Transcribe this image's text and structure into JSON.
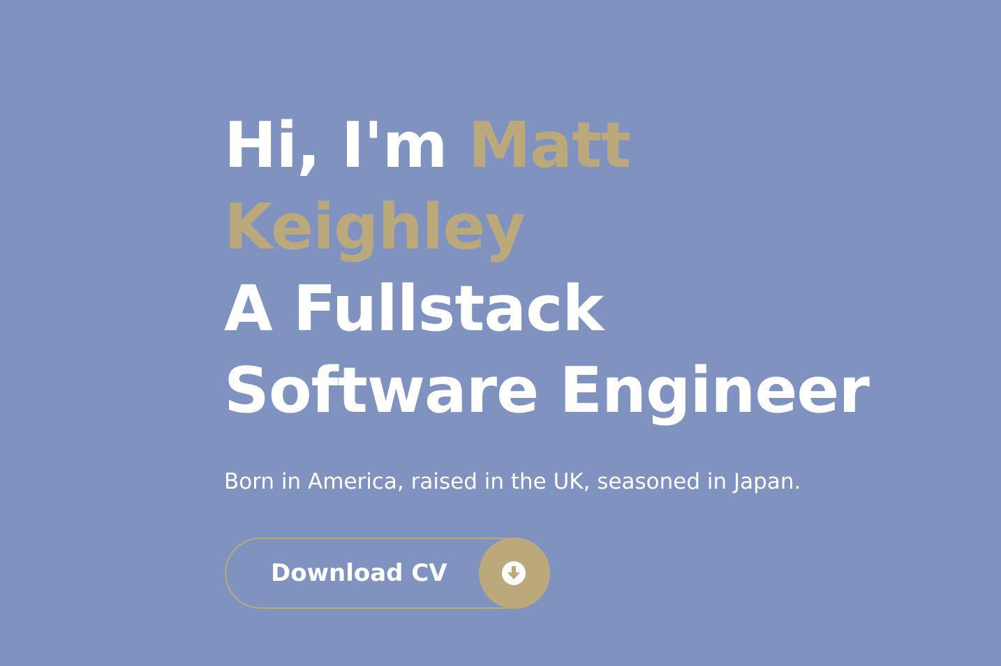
{
  "hero": {
    "greeting": "Hi, I'm ",
    "first_name": "Matt",
    "last_name": "Keighley",
    "role_line1": "A Fullstack",
    "role_line2": "Software Engineer",
    "tagline": "Born in America, raised in the UK, seasoned in Japan."
  },
  "cv_button": {
    "label": "Download CV",
    "icon": "download-arrow-circle-icon"
  },
  "colors": {
    "background": "#8092bf",
    "accent": "#bba97c",
    "text": "#ffffff"
  }
}
